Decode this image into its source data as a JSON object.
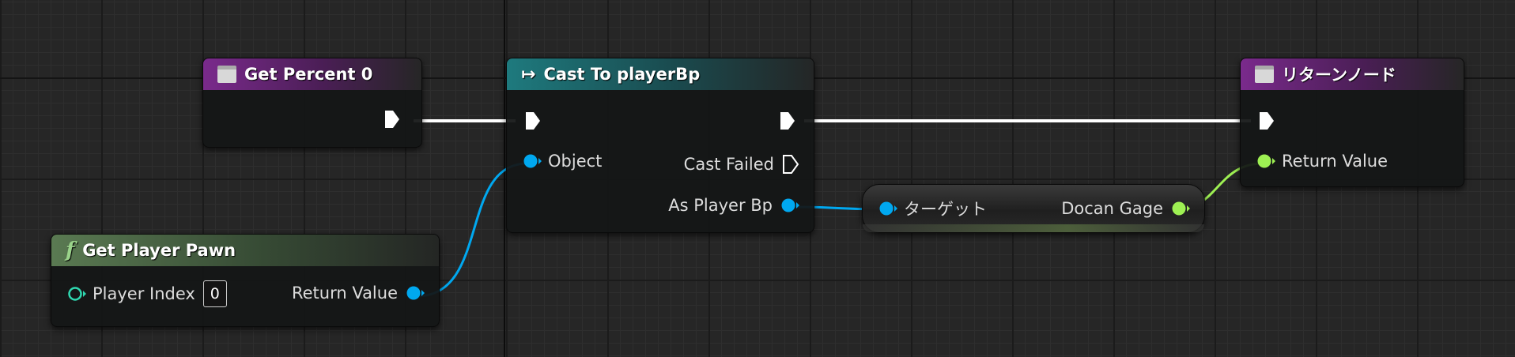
{
  "nodes": {
    "get_percent": {
      "title": "Get Percent 0"
    },
    "cast": {
      "title": "Cast To playerBp",
      "object_label": "Object",
      "cast_failed_label": "Cast Failed",
      "as_player_label": "As Player Bp"
    },
    "return_node": {
      "title": "リターンノード",
      "return_label": "Return Value"
    },
    "get_player_pawn": {
      "title": "Get Player Pawn",
      "player_index_label": "Player Index",
      "player_index_value": "0",
      "return_label": "Return Value"
    },
    "variable_get": {
      "target_label": "ターゲット",
      "var_label": "Docan Gage"
    }
  },
  "icons": {
    "exec_pin": "white-pentagon-arrow",
    "object_pin": "blue-circle-arrow",
    "float_pin": "green-circle-arrow",
    "int_pin": "teal-hollow-circle",
    "function_icon": "italic-f",
    "return_icon": "box-icon",
    "cast_icon": "arrow-right-icon"
  },
  "colors": {
    "exec": "#ffffff",
    "object": "#00a8f0",
    "float": "#9ef053",
    "int": "#2fd8b0",
    "header_purple": "#7a2a8c",
    "header_teal": "#1e7a7e",
    "header_green": "#5a7a52",
    "background": "#262626"
  }
}
